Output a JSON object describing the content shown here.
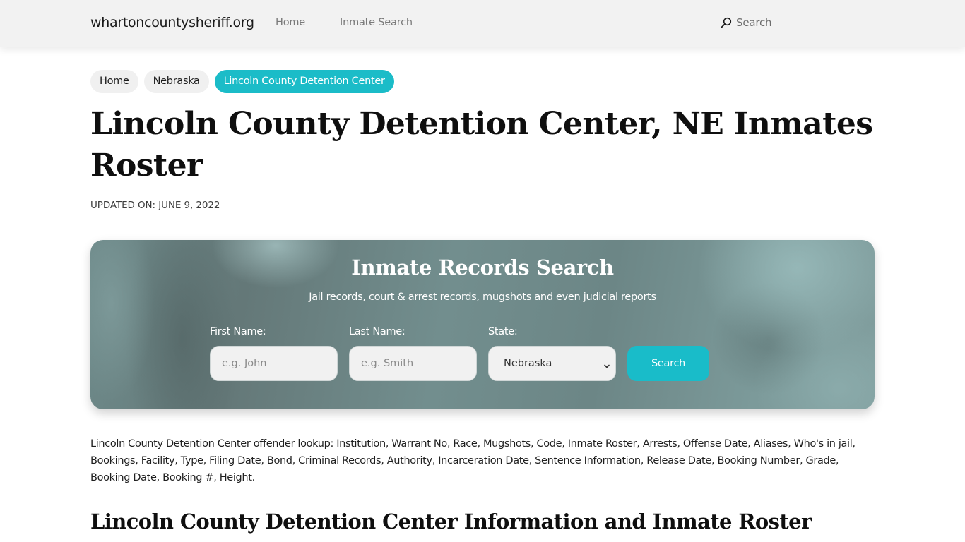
{
  "header": {
    "brand": "whartoncountysheriff.org",
    "nav": [
      {
        "label": "Home"
      },
      {
        "label": "Inmate Search"
      }
    ],
    "search_label": "Search",
    "search_icon": "search-icon"
  },
  "breadcrumb": [
    {
      "label": "Home",
      "active": false
    },
    {
      "label": "Nebraska",
      "active": false
    },
    {
      "label": "Lincoln County Detention Center",
      "active": true
    }
  ],
  "page": {
    "title": "Lincoln County Detention Center, NE Inmates Roster",
    "updated": "UPDATED ON: JUNE 9, 2022"
  },
  "search_card": {
    "title": "Inmate Records Search",
    "subtitle": "Jail records, court & arrest records, mugshots and even judicial reports",
    "first_name": {
      "label": "First Name:",
      "placeholder": "e.g. John",
      "value": ""
    },
    "last_name": {
      "label": "Last Name:",
      "placeholder": "e.g. Smith",
      "value": ""
    },
    "state": {
      "label": "State:",
      "selected": "Nebraska"
    },
    "button_label": "Search"
  },
  "description": "Lincoln County Detention Center offender lookup: Institution, Warrant No, Race, Mugshots, Code, Inmate Roster, Arrests, Offense Date, Aliases, Who's in jail, Bookings, Facility, Type, Filing Date, Bond, Criminal Records, Authority, Incarceration Date, Sentence Information, Release Date, Booking Number, Grade, Booking Date, Booking #, Height.",
  "section_heading": "Lincoln County Detention Center Information and Inmate Roster",
  "colors": {
    "accent": "#1bbcc8",
    "header_bg": "#f2f2f2",
    "crumb_bg": "#f0f0f0"
  }
}
